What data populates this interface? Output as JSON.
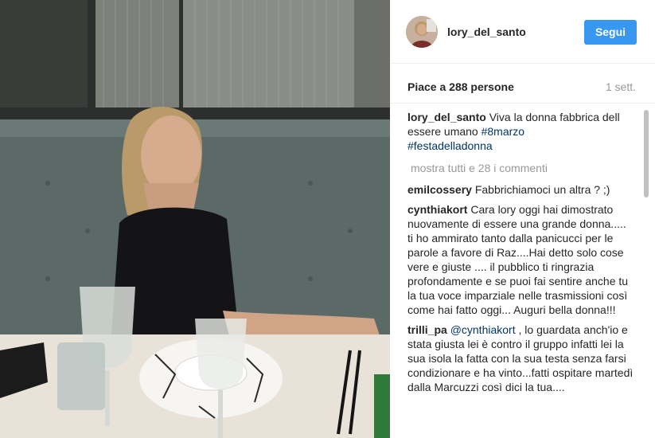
{
  "post": {
    "author": "lory_del_santo",
    "follow_label": "Segui",
    "likes_text": "Piace a 288 persone",
    "age_text": "1 sett."
  },
  "caption": {
    "user": "lory_del_santo",
    "text_before": " Viva la donna fabbrica dell essere umano ",
    "hashtag1": "#8marzo",
    "hashtag2": "#festadelladonna"
  },
  "view_all_label": "mostra tutti e 28 i commenti",
  "comments": [
    {
      "user": "emilcossery",
      "text": " Fabbrichiamoci un altra ? ;)"
    },
    {
      "user": "cynthiakort",
      "text": " Cara lory oggi hai dimostrato nuovamente di essere una grande donna..... ti ho ammirato tanto dalla panicucci per le parole a favore di Raz....Hai detto solo cose vere e giuste .... il pubblico ti ringrazia profondamente e se puoi fai sentire anche tu la tua voce imparziale nelle trasmissioni così come hai fatto oggi... Auguri bella donna!!!"
    },
    {
      "user": "trilli_pa",
      "mention": "@cynthiakort",
      "text": " , lo guardata anch'io e stata giusta lei è contro il gruppo infatti lei la sua isola la fatta con la sua testa senza farsi condizionare e ha vinto...fatti ospitare martedì dalla Marcuzzi così dici la tua...."
    }
  ],
  "colors": {
    "follow_button": "#3897f0",
    "hashtag": "#003569",
    "muted_text": "#999999"
  },
  "icons": {
    "avatar": "profile-photo"
  }
}
